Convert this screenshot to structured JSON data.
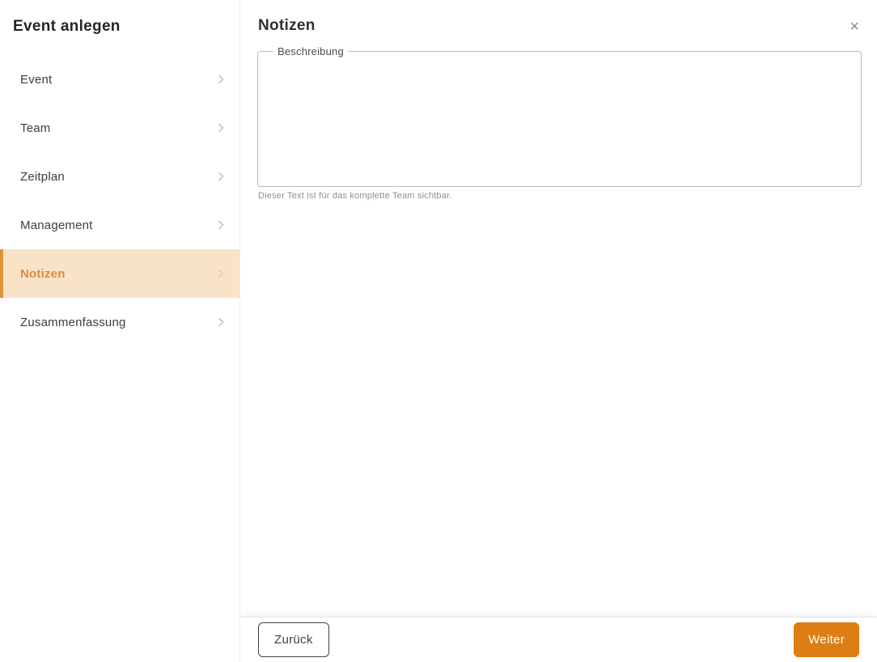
{
  "sidebar": {
    "title": "Event anlegen",
    "items": [
      {
        "label": "Event",
        "active": false
      },
      {
        "label": "Team",
        "active": false
      },
      {
        "label": "Zeitplan",
        "active": false
      },
      {
        "label": "Management",
        "active": false
      },
      {
        "label": "Notizen",
        "active": true
      },
      {
        "label": "Zusammenfassung",
        "active": false
      }
    ]
  },
  "main": {
    "title": "Notizen",
    "form": {
      "description_label": "Beschreibung",
      "description_value": "",
      "helper_text": "Dieser Text ist für das komplette Team sichtbar."
    },
    "footer": {
      "back_label": "Zurück",
      "next_label": "Weiter"
    }
  },
  "icons": {
    "close": "×",
    "chevron_right": "›"
  },
  "colors": {
    "accent_orange": "#dd7e14",
    "active_item_bg": "#f9e3c8",
    "active_item_border": "#dd9537",
    "active_item_text": "#e08a38"
  }
}
